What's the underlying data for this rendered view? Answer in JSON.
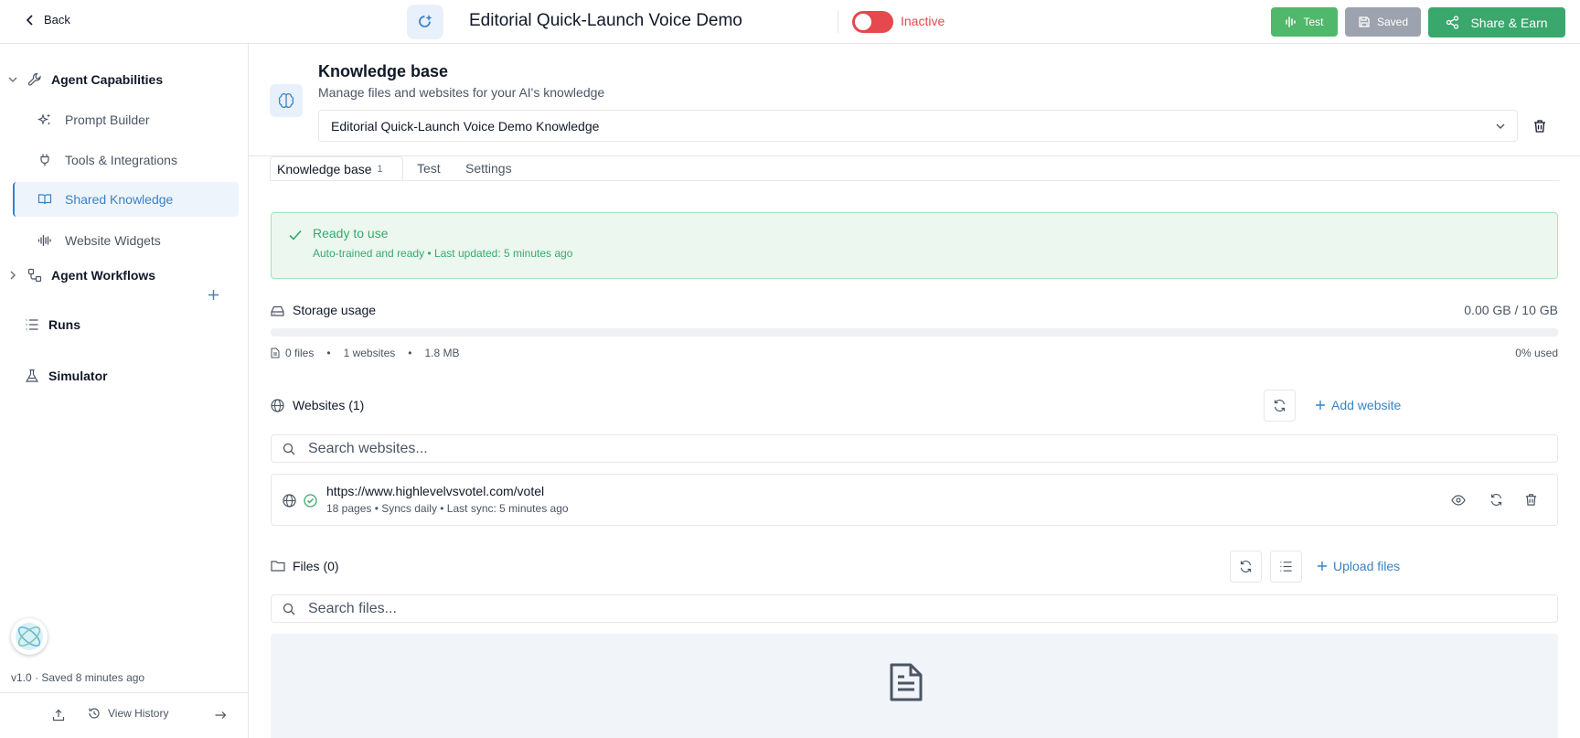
{
  "header": {
    "back_label": "Back",
    "agent_title": "Editorial Quick-Launch Voice Demo",
    "status_label": "Inactive",
    "test_label": "Test",
    "saved_label": "Saved",
    "share_label": "Share & Earn"
  },
  "sidebar": {
    "capabilities_label": "Agent Capabilities",
    "items": [
      {
        "label": "Prompt Builder",
        "icon": "sparkles-icon"
      },
      {
        "label": "Tools & Integrations",
        "icon": "plug-icon"
      },
      {
        "label": "Shared Knowledge",
        "icon": "book-icon",
        "active": true
      },
      {
        "label": "Website Widgets",
        "icon": "audio-wave-icon"
      }
    ],
    "workflows_label": "Agent Workflows",
    "runs_label": "Runs",
    "simulator_label": "Simulator",
    "version_text": "v1.0 · Saved 8 minutes ago",
    "view_history_label": "View History"
  },
  "knowledge": {
    "title": "Knowledge base",
    "subtitle": "Manage files and websites for your AI's knowledge",
    "selected": "Editorial Quick-Launch Voice Demo Knowledge",
    "tabs": [
      {
        "label": "Knowledge base",
        "count": "1"
      },
      {
        "label": "Test"
      },
      {
        "label": "Settings"
      }
    ],
    "ready_title": "Ready to use",
    "ready_sub": "Auto-trained and ready • Last updated: 5 minutes ago"
  },
  "storage": {
    "label": "Storage usage",
    "value": "0.00 GB / 10 GB",
    "used_fraction": 0.0,
    "files": "0 files",
    "websites": "1 websites",
    "size": "1.8 MB",
    "used_text": "0% used"
  },
  "websites": {
    "label": "Websites (1)",
    "add_label": "Add website",
    "search_placeholder": "Search websites...",
    "items": [
      {
        "url": "https://www.highlevelvsvotel.com/votel",
        "meta": "18 pages • Syncs daily • Last sync: 5 minutes ago"
      }
    ]
  },
  "files": {
    "label": "Files (0)",
    "upload_label": "Upload files",
    "search_placeholder": "Search files..."
  },
  "colors": {
    "accent": "#3b82c4",
    "success": "#3aa76d",
    "danger": "#e5484d",
    "test_button": "#4fb86a",
    "saved_button": "#9ca3af"
  }
}
